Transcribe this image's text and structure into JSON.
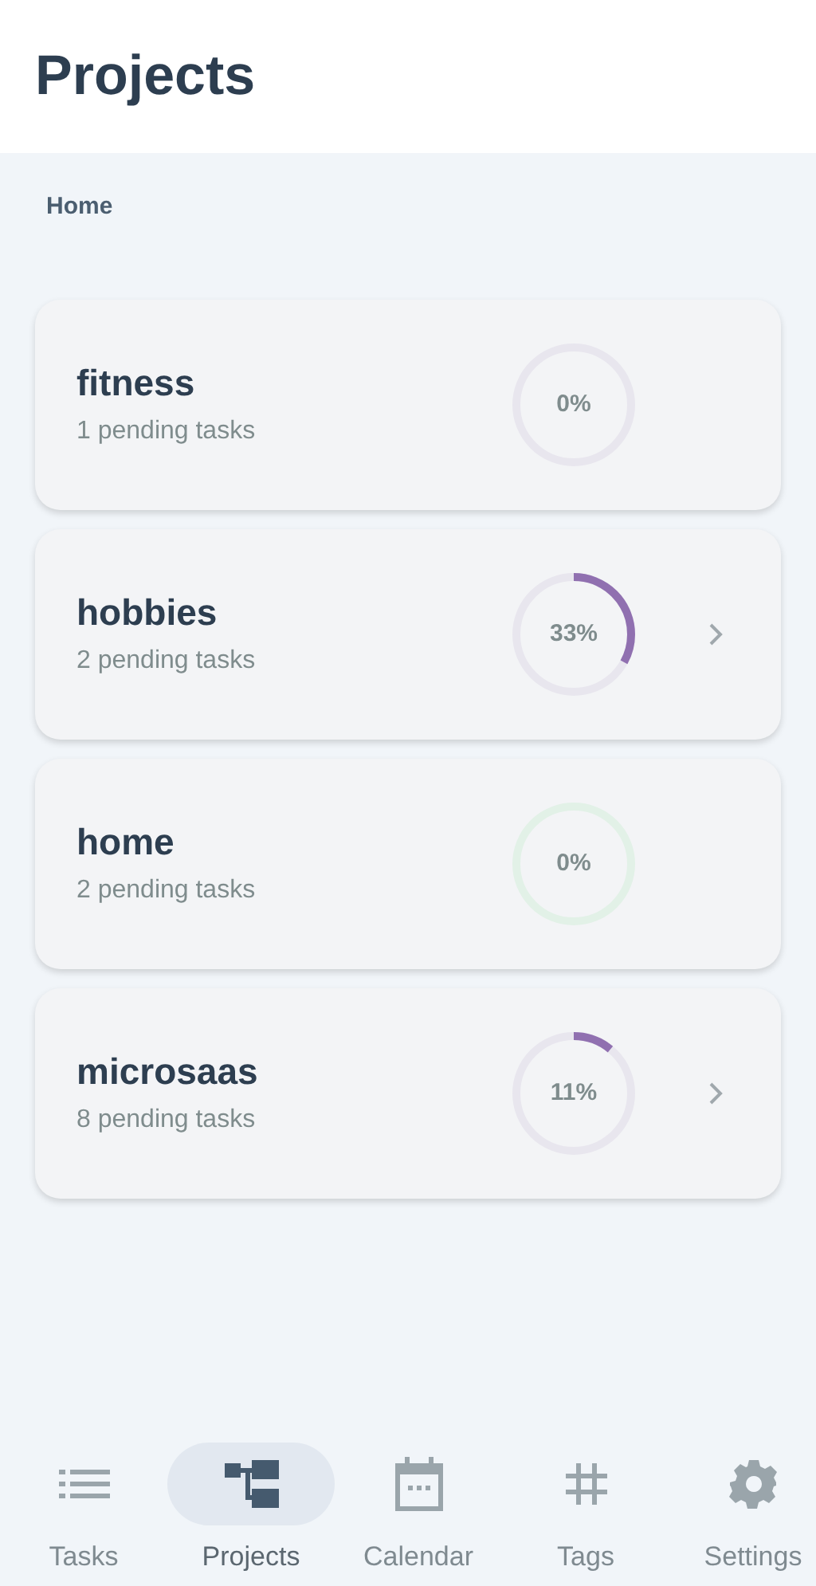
{
  "header": {
    "title": "Projects"
  },
  "breadcrumb": "Home",
  "projects": [
    {
      "name": "fitness",
      "pending": "1 pending tasks",
      "percent": "0%",
      "level": 0,
      "color": "#e8e6ee",
      "has_chevron": false
    },
    {
      "name": "hobbies",
      "pending": "2 pending tasks",
      "percent": "33%",
      "level": 0.33,
      "color": "#e8e6ee",
      "has_chevron": true
    },
    {
      "name": "home",
      "pending": "2 pending tasks",
      "percent": "0%",
      "level": 0,
      "color": "#e2f1e7",
      "has_chevron": false
    },
    {
      "name": "microsaas",
      "pending": "8 pending tasks",
      "percent": "11%",
      "level": 0.11,
      "color": "#e8e6ee",
      "has_chevron": true
    }
  ],
  "nav": [
    {
      "kind": "tasks",
      "label": "Tasks",
      "selected": false
    },
    {
      "kind": "projects",
      "label": "Projects",
      "selected": true
    },
    {
      "kind": "calendar",
      "label": "Calendar",
      "selected": false
    },
    {
      "kind": "tags",
      "label": "Tags",
      "selected": false
    },
    {
      "kind": "settings",
      "label": "Settings",
      "selected": false
    }
  ]
}
